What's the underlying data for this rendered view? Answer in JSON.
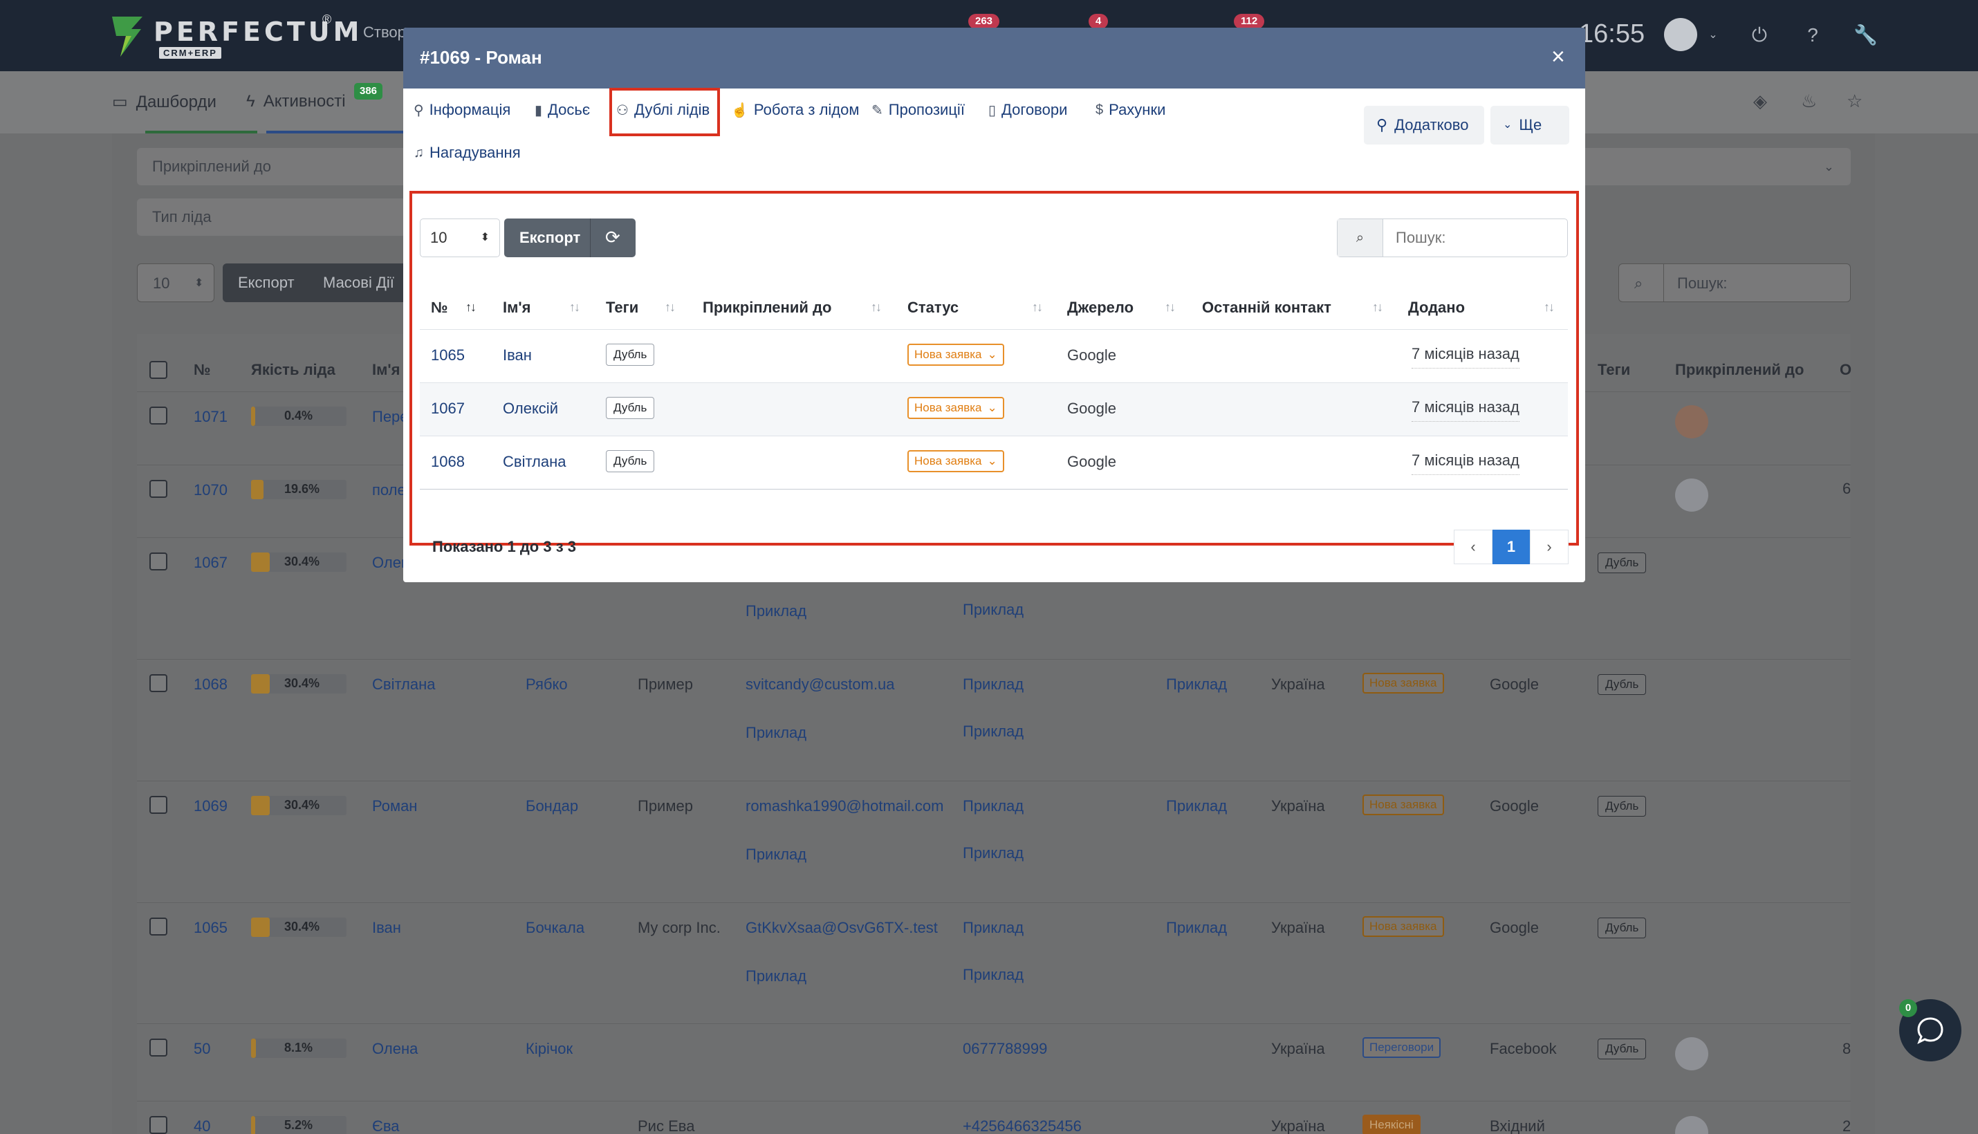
{
  "topbar": {
    "logo_text": "PERFECTUM",
    "logo_sub": "CRM+ERP",
    "create_label": "Створ",
    "badges": [
      "263",
      "4",
      "112"
    ],
    "clock": "16:55"
  },
  "subnav": {
    "items": [
      {
        "label": "Дашборди",
        "icon": "monitor-icon"
      },
      {
        "label": "Активності",
        "icon": "lightning-icon",
        "badge": "386"
      }
    ]
  },
  "background": {
    "filters": [
      "Прикріплений до",
      "Тип ліда"
    ],
    "page_size": "10",
    "export_label": "Експорт",
    "mass_label": "Масові Дії",
    "search_placeholder": "Пошук:",
    "headers": [
      "№",
      "Якість ліда",
      "Ім'я",
      "Теги",
      "Прикріплений до",
      "О"
    ],
    "rows": [
      {
        "id": "1071",
        "quality": "0.4%",
        "quality_value": 0.004,
        "name": "Пере"
      },
      {
        "id": "1070",
        "quality": "19.6%",
        "quality_value": 0.196,
        "name": "поле"
      },
      {
        "id": "1067",
        "quality": "30.4%",
        "quality_value": 0.304,
        "name": "Олек",
        "tag": "Дубль",
        "email2": "Приклад",
        "phone": "Приклад"
      },
      {
        "id": "1068",
        "quality": "30.4%",
        "quality_value": 0.304,
        "name": "Світлана",
        "surname": "Рябко",
        "company": "Пример",
        "email": "svitcandy@custom.ua",
        "email2": "Приклад",
        "phone": "Приклад",
        "phone2": "Приклад",
        "col": "Приклад",
        "country": "Україна",
        "status": "Нова заявка",
        "source": "Google",
        "tag": "Дубль"
      },
      {
        "id": "1069",
        "quality": "30.4%",
        "quality_value": 0.304,
        "name": "Роман",
        "surname": "Бондар",
        "company": "Пример",
        "email": "romashka1990@hotmail.com",
        "email2": "Приклад",
        "phone": "Приклад",
        "phone2": "Приклад",
        "col": "Приклад",
        "country": "Україна",
        "status": "Нова заявка",
        "source": "Google",
        "tag": "Дубль"
      },
      {
        "id": "1065",
        "quality": "30.4%",
        "quality_value": 0.304,
        "name": "Іван",
        "surname": "Бочкала",
        "company": "My corp Inc.",
        "email": "GtKkvXsaa@OsvG6TX-.test",
        "email2": "Приклад",
        "phone": "Приклад",
        "phone2": "Приклад",
        "col": "Приклад",
        "country": "Україна",
        "status": "Нова заявка",
        "source": "Google",
        "tag": "Дубль"
      },
      {
        "id": "50",
        "quality": "8.1%",
        "quality_value": 0.081,
        "name": "Олена",
        "surname": "Кірічок",
        "phone": "0677788999",
        "country": "Україна",
        "status": "Переговори",
        "source": "Facebook",
        "tag": "Дубль",
        "extra": "8"
      },
      {
        "id": "40",
        "quality": "5.2%",
        "quality_value": 0.052,
        "name": "Єва",
        "company": "Рис Ева",
        "phone": "+4256466325456",
        "country": "Україна",
        "status": "Неякісні",
        "source": "Вхідний",
        "extra": "2"
      }
    ],
    "row1070_extra": "6"
  },
  "chat": {
    "badge": "0"
  },
  "modal": {
    "title": "#1069 - Роман",
    "close": "×",
    "tabs": [
      {
        "label": "Інформація",
        "icon": "user-icon"
      },
      {
        "label": "Досьє",
        "icon": "book-icon"
      },
      {
        "label": "Дублі лідів",
        "icon": "users-icon"
      },
      {
        "label": "Робота з лідом",
        "icon": "hand-icon"
      },
      {
        "label": "Пропозиції",
        "icon": "pencil-icon"
      },
      {
        "label": "Договори",
        "icon": "document-icon"
      },
      {
        "label": "Рахунки",
        "icon": "dollar-icon"
      },
      {
        "label": "Нагадування",
        "icon": "bell-icon"
      }
    ],
    "extra_button": "Додатково",
    "more_button": "Ще",
    "page_size": "10",
    "export_label": "Експорт",
    "search_placeholder": "Пошук:",
    "columns": [
      "№",
      "Ім'я",
      "Теги",
      "Прикріплений до",
      "Статус",
      "Джерело",
      "Останній контакт",
      "Додано"
    ],
    "rows": [
      {
        "id": "1065",
        "name": "Іван",
        "tag": "Дубль",
        "attached": "",
        "status": "Нова заявка",
        "source": "Google",
        "last_contact": "",
        "added": "7 місяців назад"
      },
      {
        "id": "1067",
        "name": "Олексій",
        "tag": "Дубль",
        "attached": "",
        "status": "Нова заявка",
        "source": "Google",
        "last_contact": "",
        "added": "7 місяців назад"
      },
      {
        "id": "1068",
        "name": "Світлана",
        "tag": "Дубль",
        "attached": "",
        "status": "Нова заявка",
        "source": "Google",
        "last_contact": "",
        "added": "7 місяців назад"
      }
    ],
    "footer_text": "Показано 1 до 3 з 3",
    "pagination": {
      "prev": "‹",
      "current": "1",
      "next": "›"
    }
  }
}
